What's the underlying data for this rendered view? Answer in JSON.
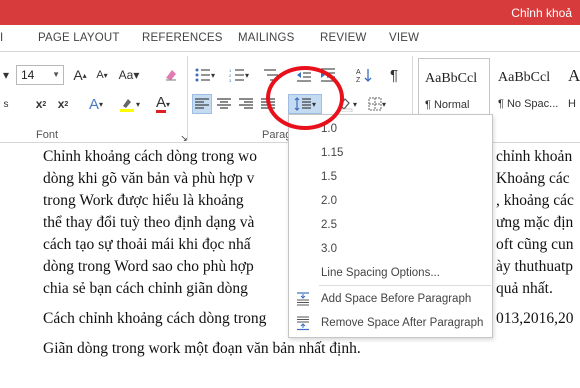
{
  "titlebar": {
    "title": "Chỉnh khoả"
  },
  "tabs": [
    "PAGE LAYOUT",
    "REFERENCES",
    "MAILINGS",
    "REVIEW",
    "VIEW"
  ],
  "ribbon": {
    "font_size": "14",
    "groups": {
      "font": "Font",
      "paragraph": "Parag"
    },
    "styles": [
      {
        "sample": "AaBbCcl",
        "name": "¶ Normal"
      },
      {
        "sample": "AaBbCcl",
        "name": "¶ No Spac..."
      },
      {
        "sample": "A",
        "name": "H"
      }
    ]
  },
  "line_spacing_menu": {
    "options": [
      "1.0",
      "1.15",
      "1.5",
      "2.0",
      "2.5",
      "3.0"
    ],
    "more": "Line Spacing Options...",
    "add_before": "Add Space Before Paragraph",
    "remove_after": "Remove Space After Paragraph"
  },
  "document": {
    "lines": [
      "Chỉnh khoảng cách dòng trong wo",
      "dòng khi gõ văn bản và phù hợp v",
      "trong Work được hiểu là khoảng",
      "thể thay đổi tuỳ theo định dạng và",
      "cách tạo sự thoải mái khi đọc nhấ",
      "dòng trong Word sao cho phù hợp",
      "chia sẻ bạn cách chỉnh giãn dòng",
      "Cách chỉnh khoảng cách dòng trong",
      "Giãn dòng trong work một đoạn văn bản nhất định."
    ],
    "right_fragments": [
      "chỉnh khoản",
      "Khoảng các",
      ", khoảng các",
      "ưng mặc địn",
      "oft cũng cun",
      "ày thuthuatp",
      "quả nhất.",
      "013,2016,20"
    ]
  }
}
